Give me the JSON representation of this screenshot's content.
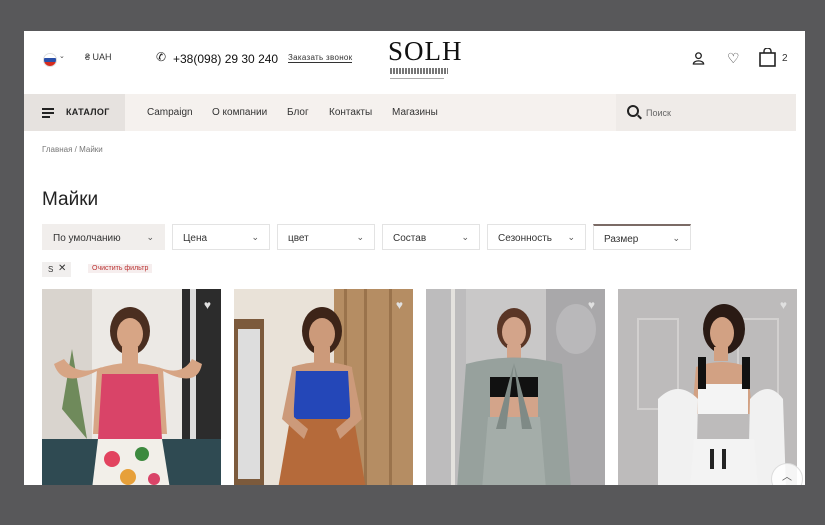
{
  "header": {
    "currency": "₴ UAH",
    "phone": "+38(098) 29 30 240",
    "callback_label": "Заказать звонок",
    "logo": "SOLH",
    "cart_count": "2"
  },
  "nav": {
    "catalog_label": "КАТАЛОГ",
    "links": [
      "Campaign",
      "О компании",
      "Блог",
      "Контакты",
      "Магазины"
    ],
    "search_placeholder": "Поиск"
  },
  "breadcrumb": "Главная  / Майки",
  "page_title": "Майки",
  "filters": [
    {
      "label": "По умолчанию"
    },
    {
      "label": "Цена"
    },
    {
      "label": "цвет"
    },
    {
      "label": "Состав"
    },
    {
      "label": "Сезонность"
    },
    {
      "label": "Размер"
    }
  ],
  "active_tag": {
    "label": "S"
  },
  "clear_filter_label": "Очистить фильтр"
}
